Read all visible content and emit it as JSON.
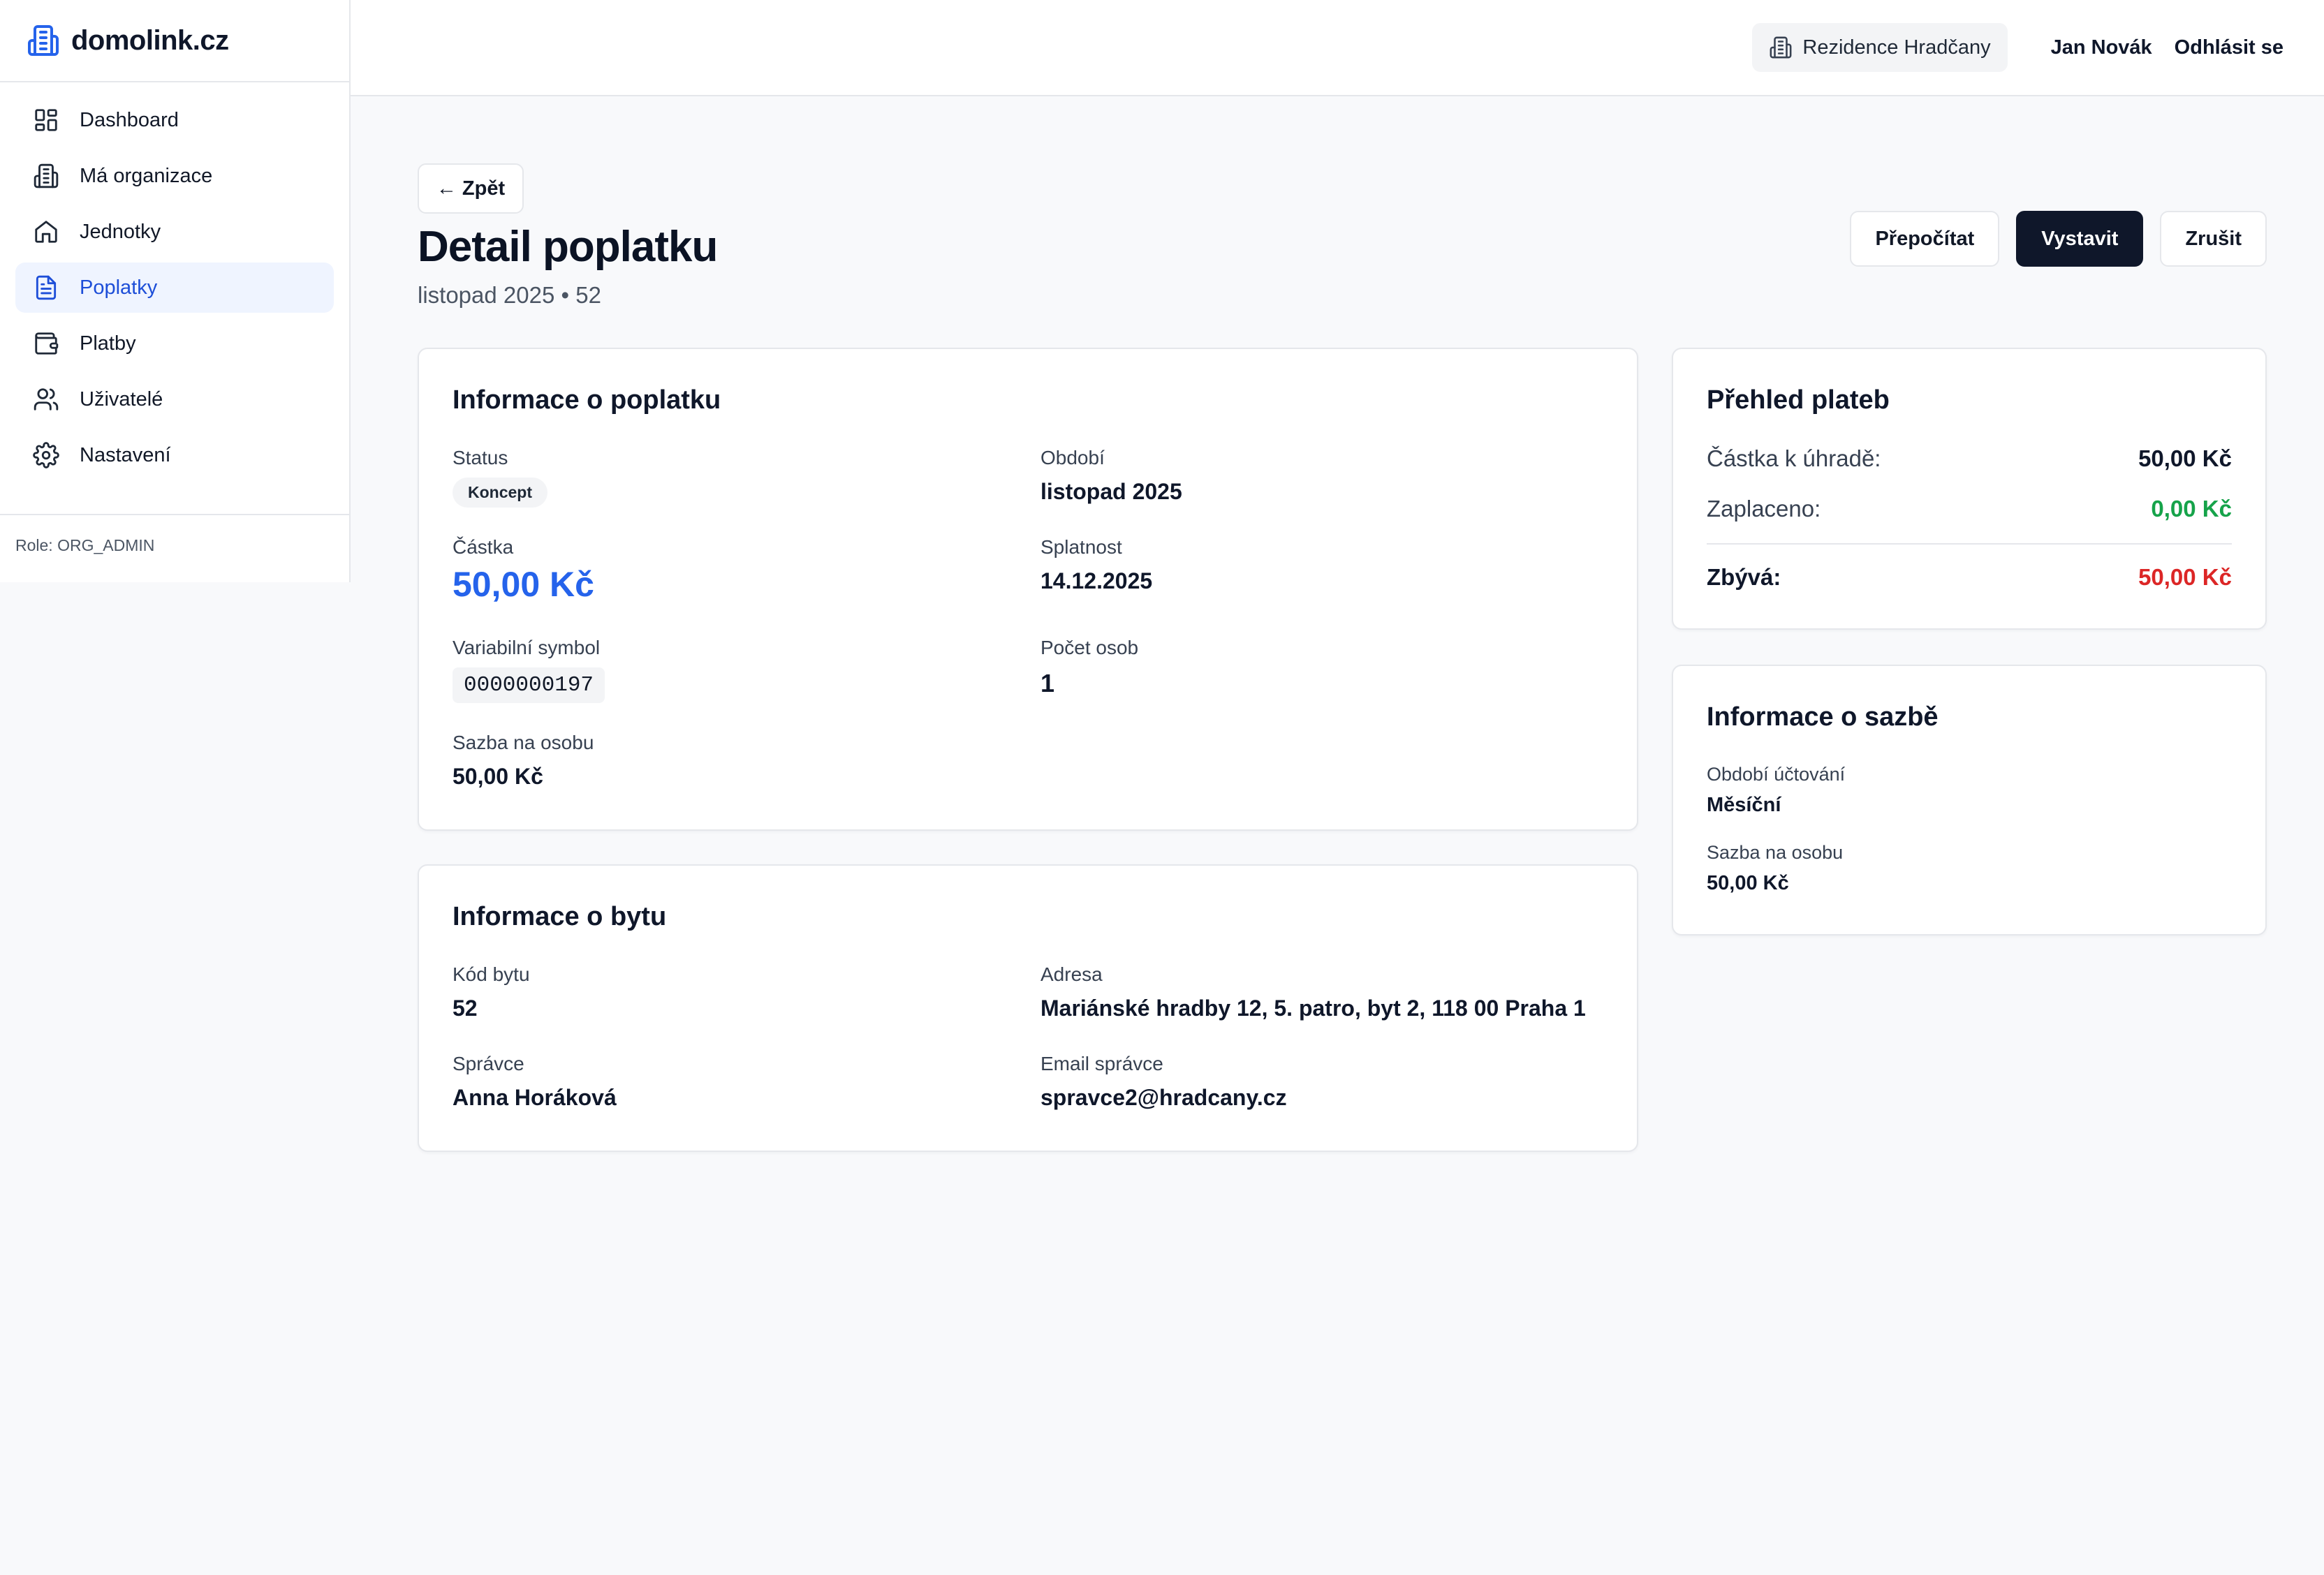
{
  "sidebar": {
    "brand": "domolink.cz",
    "items": [
      {
        "label": "Dashboard",
        "icon": "dashboard-grid-icon"
      },
      {
        "label": "Má organizace",
        "icon": "building-icon"
      },
      {
        "label": "Jednotky",
        "icon": "home-icon"
      },
      {
        "label": "Poplatky",
        "icon": "document-icon",
        "active": true
      },
      {
        "label": "Platby",
        "icon": "wallet-icon"
      },
      {
        "label": "Uživatelé",
        "icon": "users-icon"
      },
      {
        "label": "Nastavení",
        "icon": "gear-icon"
      }
    ],
    "role": "Role: ORG_ADMIN"
  },
  "header": {
    "organization": "Rezidence Hradčany",
    "user": "Jan Novák",
    "logout": "Odhlásit se"
  },
  "page": {
    "back": "← Zpět",
    "title": "Detail poplatku",
    "subtitle": "listopad 2025 • 52",
    "actions": {
      "recalculate": "Přepočítat",
      "issue": "Vystavit",
      "cancel": "Zrušit"
    }
  },
  "fee_info": {
    "title": "Informace o poplatku",
    "status_label": "Status",
    "status_value": "Koncept",
    "period_label": "Období",
    "period_value": "listopad 2025",
    "amount_label": "Částka",
    "amount_value": "50,00 Kč",
    "due_label": "Splatnost",
    "due_value": "14.12.2025",
    "vs_label": "Variabilní symbol",
    "vs_value": "0000000197",
    "persons_label": "Počet osob",
    "persons_value": "1",
    "rate_label": "Sazba na osobu",
    "rate_value": "50,00 Kč"
  },
  "unit_info": {
    "title": "Informace o bytu",
    "code_label": "Kód bytu",
    "code_value": "52",
    "address_label": "Adresa",
    "address_value": "Mariánské hradby 12, 5. patro, byt 2, 118 00 Praha 1",
    "manager_label": "Správce",
    "manager_value": "Anna Horáková",
    "email_label": "Email správce",
    "email_value": "spravce2@hradcany.cz"
  },
  "payments_overview": {
    "title": "Přehled plateb",
    "due_label": "Částka k úhradě:",
    "due_value": "50,00 Kč",
    "paid_label": "Zaplaceno:",
    "paid_value": "0,00 Kč",
    "remaining_label": "Zbývá:",
    "remaining_value": "50,00 Kč"
  },
  "rate_info": {
    "title": "Informace o sazbě",
    "billing_period_label": "Období účtování",
    "billing_period_value": "Měsíční",
    "rate_label": "Sazba na osobu",
    "rate_value": "50,00 Kč"
  },
  "colors": {
    "accent": "#2563eb",
    "primary_button": "#0f172a",
    "paid_green": "#16a34a",
    "remaining_red": "#dc2626"
  }
}
